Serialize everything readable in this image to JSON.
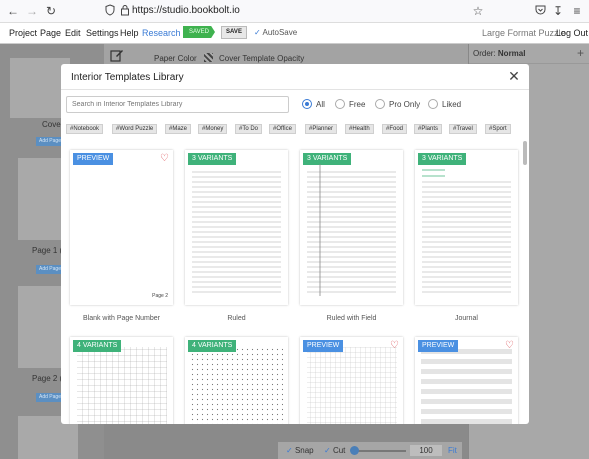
{
  "browser": {
    "url": "https://studio.bookbolt.io",
    "icons": [
      "back-icon",
      "forward-icon",
      "reload-icon",
      "shield-icon",
      "lock-icon",
      "star-icon",
      "pocket-icon",
      "download-icon",
      "menu-icon"
    ]
  },
  "menubar": {
    "items": [
      "Project",
      "Page",
      "Edit",
      "Settings",
      "Help",
      "Research"
    ],
    "saved_label": "SAVED",
    "save_label": "SAVE",
    "autosave_label": "AutoSave",
    "large_format_label": "Large Format Puzzle",
    "logout_label": "Log Out"
  },
  "background": {
    "paper_color_label": "Paper Color",
    "cover_opacity_label": "Cover Template Opacity",
    "order_label": "Order:",
    "order_value": "Normal",
    "cover_label": "Cover",
    "page1_label": "Page 1 (O",
    "page2_label": "Page 2 (E",
    "add_page_label": "Add Page"
  },
  "bottombar": {
    "snap_label": "Snap",
    "cut_label": "Cut",
    "zoom_value": "100",
    "fit_label": "Fit"
  },
  "modal": {
    "title": "Interior Templates Library",
    "search_placeholder": "Search in Interior Templates Library",
    "filters": [
      {
        "label": "All",
        "selected": true
      },
      {
        "label": "Free",
        "selected": false
      },
      {
        "label": "Pro Only",
        "selected": false
      },
      {
        "label": "Liked",
        "selected": false
      }
    ],
    "tags": [
      "#Notebook",
      "#Word Puzzle",
      "#Maze",
      "#Money",
      "#To Do",
      "#Office",
      "#Planner",
      "#Health",
      "#Food",
      "#Plants",
      "#Travel",
      "#Sport"
    ],
    "cards": [
      {
        "name": "Blank with Page Number",
        "badge": "PREVIEW",
        "badge_color": "#4a90e2",
        "liked": true,
        "page_label": "Page 2"
      },
      {
        "name": "Ruled",
        "badge": "3 VARIANTS",
        "badge_color": "#3fb27a",
        "liked": false
      },
      {
        "name": "Ruled with Field",
        "badge": "3 VARIANTS",
        "badge_color": "#3fb27a",
        "liked": false
      },
      {
        "name": "Journal",
        "badge": "3 VARIANTS",
        "badge_color": "#3fb27a",
        "liked": false
      },
      {
        "name": "",
        "badge": "4 VARIANTS",
        "badge_color": "#3fb27a",
        "liked": false
      },
      {
        "name": "",
        "badge": "4 VARIANTS",
        "badge_color": "#3fb27a",
        "liked": false
      },
      {
        "name": "",
        "badge": "PREVIEW",
        "badge_color": "#4a90e2",
        "liked": true
      },
      {
        "name": "",
        "badge": "PREVIEW",
        "badge_color": "#4a90e2",
        "liked": true
      }
    ]
  }
}
